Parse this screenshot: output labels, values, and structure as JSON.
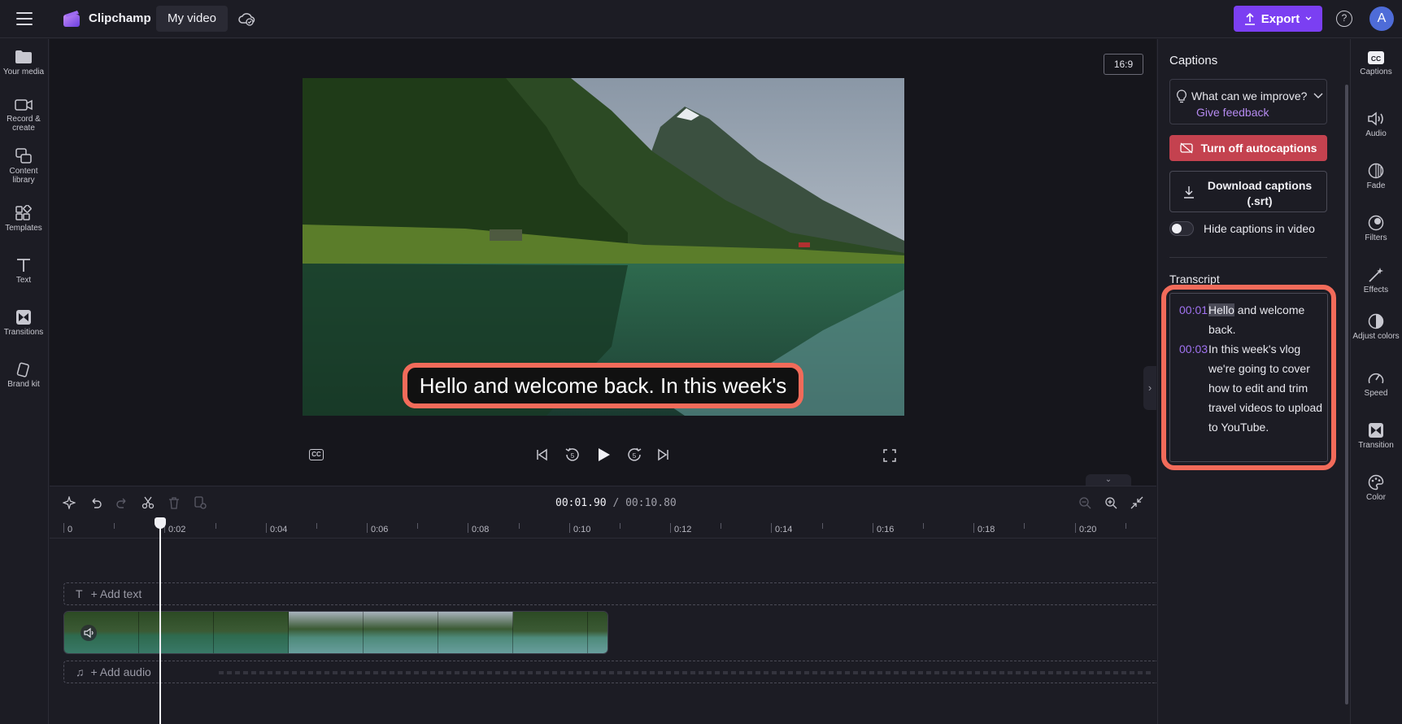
{
  "app": {
    "brand": "Clipchamp",
    "project_name": "My video"
  },
  "header": {
    "export_label": "Export",
    "help": "?",
    "avatar_initial": "A"
  },
  "left_sidebar": {
    "items": [
      {
        "label": "Your media",
        "icon": "folder-icon"
      },
      {
        "label": "Record & create",
        "icon": "camera-icon"
      },
      {
        "label": "Content library",
        "icon": "library-icon"
      },
      {
        "label": "Templates",
        "icon": "templates-icon"
      },
      {
        "label": "Text",
        "icon": "text-icon"
      },
      {
        "label": "Transitions",
        "icon": "transitions-icon"
      },
      {
        "label": "Brand kit",
        "icon": "brand-kit-icon"
      }
    ]
  },
  "preview": {
    "aspect_ratio": "16:9",
    "caption_text": "Hello and welcome back. In this week's"
  },
  "timeline": {
    "current_time": "00:01.90",
    "total_time": "/ 00:10.80",
    "ruler_labels": [
      "0",
      "0:02",
      "0:04",
      "0:06",
      "0:08",
      "0:10",
      "0:12",
      "0:14",
      "0:16",
      "0:18",
      "0:20"
    ],
    "add_text_label": "+ Add text",
    "add_audio_label": "+ Add audio"
  },
  "captions_panel": {
    "title": "Captions",
    "feedback_question": "What can we improve?",
    "feedback_link": "Give feedback",
    "turn_off_label": "Turn off autocaptions",
    "download_label": "Download captions (.srt)",
    "hide_toggle_label": "Hide captions in video",
    "hide_toggle_on": false,
    "transcript_title": "Transcript",
    "transcript": [
      {
        "time": "00:01",
        "highlight": "Hello",
        "text": "and welcome back."
      },
      {
        "time": "00:03",
        "highlight": "",
        "text": "In this week's vlog we're going to cover how to edit and trim travel videos to upload to YouTube."
      }
    ]
  },
  "right_tools": {
    "items": [
      {
        "label": "Captions",
        "icon": "captions-icon"
      },
      {
        "label": "Audio",
        "icon": "speaker-icon"
      },
      {
        "label": "Fade",
        "icon": "fade-icon"
      },
      {
        "label": "Filters",
        "icon": "filters-icon"
      },
      {
        "label": "Effects",
        "icon": "effects-icon"
      },
      {
        "label": "Adjust colors",
        "icon": "adjust-colors-icon"
      },
      {
        "label": "Speed",
        "icon": "speed-icon"
      },
      {
        "label": "Transition",
        "icon": "transition-icon"
      },
      {
        "label": "Color",
        "icon": "palette-icon"
      }
    ]
  },
  "colors": {
    "accent": "#7b3ff2",
    "danger": "#c4424f",
    "highlight_ring": "#f26b5a",
    "timestamp": "#a072f0",
    "link": "#b58af0"
  }
}
